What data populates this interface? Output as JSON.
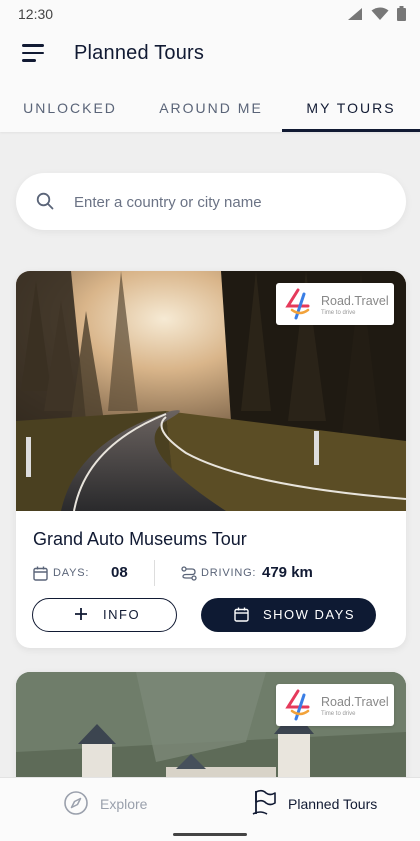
{
  "status_bar": {
    "time": "12:30"
  },
  "header": {
    "title": "Planned Tours"
  },
  "tabs": [
    {
      "label": "UNLOCKED",
      "active": false
    },
    {
      "label": "AROUND ME",
      "active": false
    },
    {
      "label": "MY TOURS",
      "active": true
    }
  ],
  "search": {
    "placeholder": "Enter a country or city name",
    "value": ""
  },
  "brand": {
    "name": "Road.Travel",
    "tagline": "Time to drive"
  },
  "tours": [
    {
      "title": "Grand Auto Museums Tour",
      "days_label": "DAYS:",
      "days_value": "08",
      "driving_label": "DRIVING:",
      "driving_value": "479 km",
      "info_label": "INFO",
      "show_days_label": "SHOW DAYS"
    }
  ],
  "bottom_nav": [
    {
      "label": "Explore",
      "icon": "compass-icon",
      "active": false
    },
    {
      "label": "Planned Tours",
      "icon": "flag-icon",
      "active": true
    }
  ],
  "colors": {
    "primary": "#0e1a33",
    "muted": "#5a6478",
    "inactive": "#9aa0ac"
  }
}
